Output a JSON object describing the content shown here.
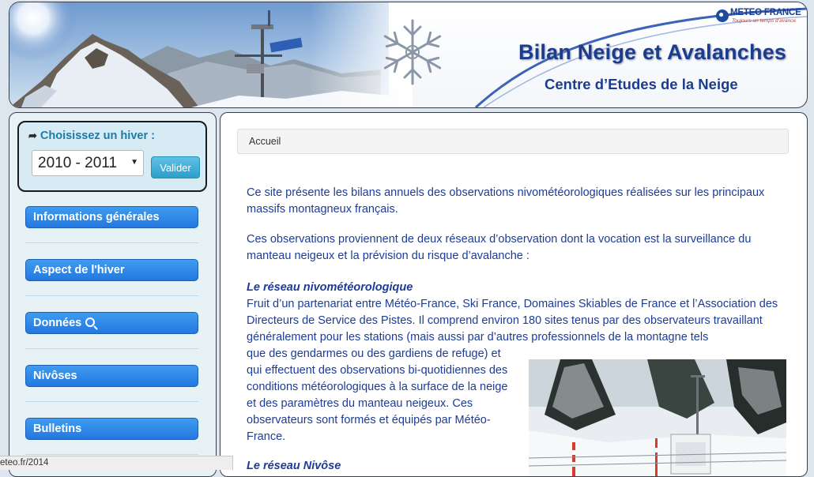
{
  "banner": {
    "title": "Bilan Neige et Avalanches",
    "subtitle": "Centre d’Etudes de la Neige",
    "logo": {
      "name": "METEO FRANCE",
      "tagline": "Toujours un temps d’avance"
    }
  },
  "sidebar": {
    "winter_selector": {
      "label": "Choisissez un hiver :",
      "selected": "2010 - 2011",
      "submit_label": "Valider"
    },
    "nav": [
      {
        "label": "Informations générales"
      },
      {
        "label": "Aspect de l'hiver"
      },
      {
        "label": "Données",
        "icon": "search-icon"
      },
      {
        "label": "Nivôses"
      },
      {
        "label": "Bulletins"
      }
    ]
  },
  "main": {
    "breadcrumb": {
      "home": "Accueil"
    },
    "intro": [
      "Ce site présente les bilans annuels des observations nivométéorologiques réalisées sur les principaux massifs montagneux français.",
      "Ces observations proviennent de deux réseaux d’observation dont la vocation est la surveillance du manteau neigeux et la prévision du risque d’avalanche :"
    ],
    "sections": [
      {
        "title": "Le réseau nivométéorologique",
        "body": "Fruit d’un partenariat entre Météo-France, Ski France, Domaines Skiables de France et l’Association des Directeurs de Service des Pistes. Il comprend environ 180 sites tenus par des observateurs travaillant généralement pour les stations (mais aussi par d’autres professionnels de la montagne tels",
        "body_continued": "que des gendarmes ou des gardiens de refuge) et qui effectuent des observations bi-quotidiennes des conditions météorologiques à la surface de la neige et des paramètres du manteau neigeux. Ces observateurs sont formés et équipés par Météo-France."
      },
      {
        "title": "Le réseau Nivôse"
      }
    ]
  },
  "status_bar": {
    "url": "eteo.fr/2014"
  },
  "colors": {
    "title_blue": "#1c3c8f",
    "text_blue": "#1d3c97",
    "nav_blue": "#2378df",
    "accent_cyan": "#2b9fcb"
  }
}
